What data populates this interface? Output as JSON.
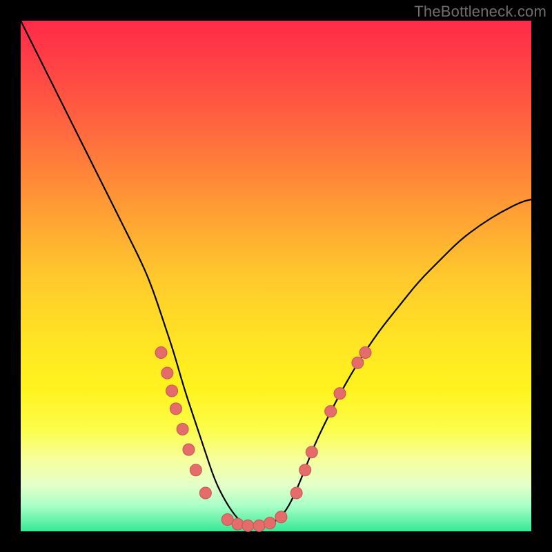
{
  "watermark": "TheBottleneck.com",
  "colors": {
    "background": "#000000",
    "curve_stroke": "#000000",
    "marker_fill": "#e46d6b",
    "marker_stroke": "#c9524f"
  },
  "chart_data": {
    "type": "line",
    "title": "",
    "xlabel": "",
    "ylabel": "",
    "xlim": [
      0,
      100
    ],
    "ylim": [
      0,
      100
    ],
    "grid": false,
    "series": [
      {
        "name": "bottleneck-curve",
        "x": [
          0,
          4,
          8,
          12,
          16,
          20,
          24,
          26,
          28,
          30,
          32,
          34,
          36,
          38,
          40,
          42,
          44,
          46,
          48,
          50,
          52,
          54,
          56,
          58,
          62,
          66,
          70,
          74,
          78,
          82,
          86,
          90,
          94,
          98,
          100
        ],
        "y": [
          100,
          92,
          84,
          76,
          68,
          60,
          52,
          47,
          41,
          35,
          28,
          22,
          16,
          10,
          6,
          3,
          1,
          1,
          1,
          2,
          4,
          8,
          13,
          18,
          26,
          33,
          39,
          44,
          49,
          53,
          57,
          60,
          62.5,
          64.5,
          65
        ]
      }
    ],
    "markers": {
      "name": "highlight-points",
      "points": [
        {
          "x": 27.5,
          "y": 35
        },
        {
          "x": 28.7,
          "y": 31
        },
        {
          "x": 29.6,
          "y": 27.5
        },
        {
          "x": 30.4,
          "y": 24
        },
        {
          "x": 31.7,
          "y": 20
        },
        {
          "x": 32.9,
          "y": 16
        },
        {
          "x": 34.3,
          "y": 12
        },
        {
          "x": 36.2,
          "y": 7.5
        },
        {
          "x": 40.5,
          "y": 2.3
        },
        {
          "x": 42.5,
          "y": 1.4
        },
        {
          "x": 44.5,
          "y": 1.1
        },
        {
          "x": 46.7,
          "y": 1.1
        },
        {
          "x": 48.8,
          "y": 1.6
        },
        {
          "x": 51.0,
          "y": 2.8
        },
        {
          "x": 54.0,
          "y": 7.5
        },
        {
          "x": 55.7,
          "y": 12
        },
        {
          "x": 57.0,
          "y": 15.5
        },
        {
          "x": 60.7,
          "y": 23.5
        },
        {
          "x": 62.5,
          "y": 27
        },
        {
          "x": 66.0,
          "y": 33
        },
        {
          "x": 67.5,
          "y": 35
        }
      ]
    }
  }
}
